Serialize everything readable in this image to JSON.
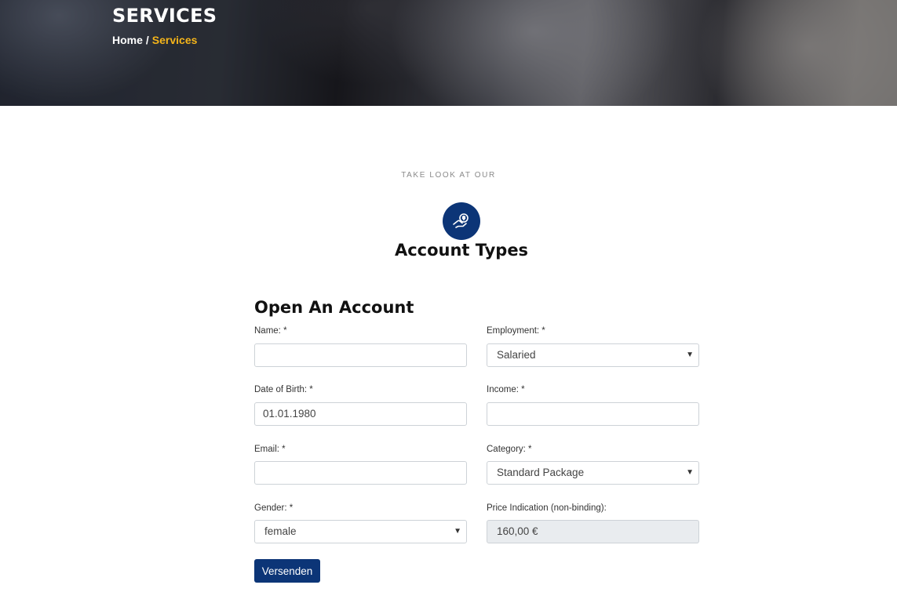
{
  "hero": {
    "title": "SERVICES",
    "breadcrumb": {
      "home": "Home",
      "separator": "/",
      "current": "Services"
    }
  },
  "section": {
    "eyebrow": "TAKE LOOK AT OUR",
    "icon": "hand-money-icon",
    "title": "Account Types"
  },
  "form": {
    "title": "Open An Account",
    "fields": {
      "name": {
        "label": "Name: *",
        "value": ""
      },
      "employment": {
        "label": "Employment: *",
        "value": "Salaried"
      },
      "dob": {
        "label": "Date of Birth: *",
        "value": "01.01.1980"
      },
      "income": {
        "label": "Income: *",
        "value": ""
      },
      "email": {
        "label": "Email: *",
        "value": ""
      },
      "category": {
        "label": "Category: *",
        "value": "Standard Package"
      },
      "gender": {
        "label": "Gender: *",
        "value": "female"
      },
      "price": {
        "label": "Price Indication (non-binding):",
        "value": "160,00 €"
      }
    },
    "submit_label": "Versenden"
  },
  "colors": {
    "primary": "#0c3577",
    "accent": "#f4b41a",
    "readonly_bg": "#e9ecef"
  }
}
